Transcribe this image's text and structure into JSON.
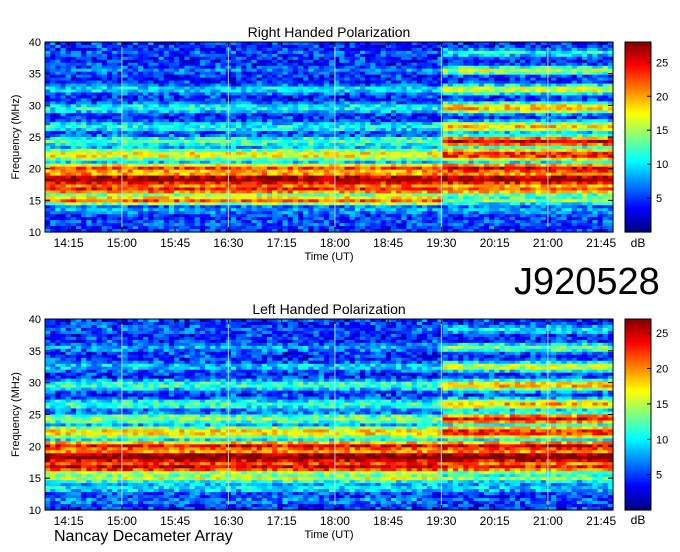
{
  "observation_id": "J920528",
  "instrument": "Nancay Decameter Array",
  "chart_data": [
    {
      "type": "heatmap",
      "title": "Right Handed Polarization",
      "xlabel": "Time (UT)",
      "ylabel": "Frequency (MHz)",
      "xlim": [
        "13:55",
        "21:55"
      ],
      "ylim": [
        10,
        40
      ],
      "x_ticks": [
        "14:15",
        "15:00",
        "15:45",
        "16:30",
        "17:15",
        "18:00",
        "18:45",
        "19:30",
        "20:15",
        "21:00",
        "21:45"
      ],
      "y_ticks": [
        10,
        15,
        20,
        25,
        30,
        35,
        40
      ],
      "colorbar": {
        "label": "dB",
        "range": [
          0,
          28
        ],
        "ticks": [
          5,
          10,
          15,
          20,
          25
        ]
      },
      "bands": [
        {
          "f": 11.5,
          "w": 0.9,
          "a": 4,
          "b": 4
        },
        {
          "f": 13.5,
          "w": 1.0,
          "a": 6,
          "b": 6
        },
        {
          "f": 15.0,
          "w": 0.8,
          "a": 20,
          "b": 13
        },
        {
          "f": 16.8,
          "w": 1.2,
          "a": 22,
          "b": 20
        },
        {
          "f": 18.3,
          "w": 1.4,
          "a": 26,
          "b": 26
        },
        {
          "f": 20.0,
          "w": 1.0,
          "a": 21,
          "b": 24
        },
        {
          "f": 22.2,
          "w": 1.2,
          "a": 16,
          "b": 22
        },
        {
          "f": 24.3,
          "w": 1.0,
          "a": 11,
          "b": 24
        },
        {
          "f": 26.6,
          "w": 1.0,
          "a": 9,
          "b": 17
        },
        {
          "f": 29.6,
          "w": 1.0,
          "a": 9,
          "b": 18
        },
        {
          "f": 32.5,
          "w": 0.9,
          "a": 8,
          "b": 15
        },
        {
          "f": 35.5,
          "w": 0.8,
          "a": 5,
          "b": 14
        },
        {
          "f": 38.3,
          "w": 0.8,
          "a": 4,
          "b": 9
        }
      ]
    },
    {
      "type": "heatmap",
      "title": "Left Handed Polarization",
      "xlabel": "Time (UT)",
      "ylabel": "Frequency (MHz)",
      "xlim": [
        "13:55",
        "21:55"
      ],
      "ylim": [
        10,
        40
      ],
      "x_ticks": [
        "14:15",
        "15:00",
        "15:45",
        "16:30",
        "17:15",
        "18:00",
        "18:45",
        "19:30",
        "20:15",
        "21:00",
        "21:45"
      ],
      "y_ticks": [
        10,
        15,
        20,
        25,
        30,
        35,
        40
      ],
      "colorbar": {
        "label": "dB",
        "range": [
          0,
          27
        ],
        "ticks": [
          5,
          10,
          15,
          20,
          25
        ]
      },
      "bands": [
        {
          "f": 11.5,
          "w": 0.9,
          "a": 5,
          "b": 4
        },
        {
          "f": 13.5,
          "w": 1.0,
          "a": 8,
          "b": 7
        },
        {
          "f": 15.0,
          "w": 0.8,
          "a": 14,
          "b": 12
        },
        {
          "f": 16.8,
          "w": 1.2,
          "a": 23,
          "b": 21
        },
        {
          "f": 18.3,
          "w": 1.4,
          "a": 26,
          "b": 26
        },
        {
          "f": 20.0,
          "w": 1.0,
          "a": 22,
          "b": 23
        },
        {
          "f": 22.2,
          "w": 1.2,
          "a": 16,
          "b": 21
        },
        {
          "f": 24.3,
          "w": 1.0,
          "a": 12,
          "b": 22
        },
        {
          "f": 26.6,
          "w": 1.0,
          "a": 10,
          "b": 17
        },
        {
          "f": 29.6,
          "w": 1.0,
          "a": 10,
          "b": 17
        },
        {
          "f": 32.5,
          "w": 0.9,
          "a": 7,
          "b": 14
        },
        {
          "f": 35.5,
          "w": 0.8,
          "a": 6,
          "b": 12
        },
        {
          "f": 38.3,
          "w": 0.8,
          "a": 4,
          "b": 8
        }
      ]
    }
  ]
}
